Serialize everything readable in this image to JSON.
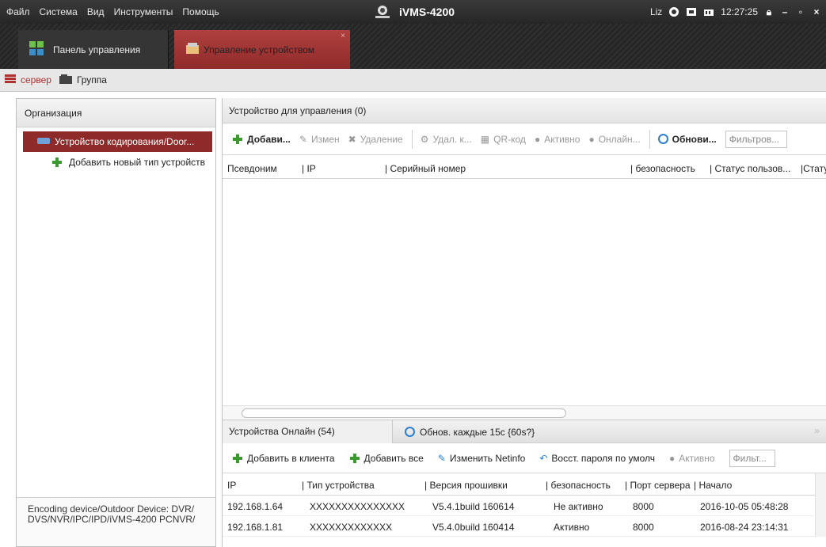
{
  "menu": [
    "Файл",
    "Система",
    "Вид",
    "Инструменты",
    "Помощь"
  ],
  "app_title": "iVMS-4200",
  "tray": {
    "user": "Liz",
    "time": "12:27:25"
  },
  "modules": {
    "tab1": "Панель управления",
    "tab2": "Управление устройством"
  },
  "subtabs": {
    "server": "сервер",
    "group": "Группа"
  },
  "left": {
    "header": "Организация",
    "selected": "Устройство кодирования/Door...",
    "add_type": "Добавить новый тип устройств",
    "footer": "Encoding device/Outdoor Device: DVR/ DVS/NVR/IPC/IPD/iVMS-4200 PCNVR/"
  },
  "managed": {
    "header": "Устройство для управления (0)",
    "toolbar": {
      "add": "Добави...",
      "edit": "Измен",
      "delete": "Удаление",
      "remote": "Удал. к...",
      "qr": "QR-код",
      "active": "Активно",
      "online": "Онлайн...",
      "refresh": "Обнови...",
      "filter_placeholder": "Фильтров..."
    },
    "columns": {
      "nick": "Псевдоним",
      "ip": "IP",
      "serial": "Серийный номер",
      "security": "безопасность",
      "user_status": "Статус пользов...",
      "status": "Статус"
    }
  },
  "online": {
    "tab": "Устройства Онлайн (54)",
    "refresh": "Обнов. каждые 15с {60s?}",
    "toolbar": {
      "add_client": "Добавить в клиента",
      "add_all": "Добавить все",
      "edit_netinfo": "Изменить Netinfo",
      "reset_pwd": "Восст. пароля по умолч",
      "active": "Активно",
      "filter": "Фильт..."
    },
    "columns": {
      "ip": "IP",
      "type": "Тип устройства",
      "firmware": "Версия прошивки",
      "security": "безопасность",
      "port": "Порт сервера",
      "start": "Начало"
    },
    "rows": [
      {
        "ip": "192.168.1.64",
        "type": "XXXXXXXXXXXXXXX",
        "firmware": "V5.4.1build 160614",
        "security": "Не активно",
        "port": "8000",
        "start": "2016-10-05 05:48:28"
      },
      {
        "ip": "192.168.1.81",
        "type": "XXXXXXXXXXXXX",
        "firmware": "V5.4.0build 160414",
        "security": "Активно",
        "port": "8000",
        "start": "2016-08-24 23:14:31"
      }
    ]
  }
}
